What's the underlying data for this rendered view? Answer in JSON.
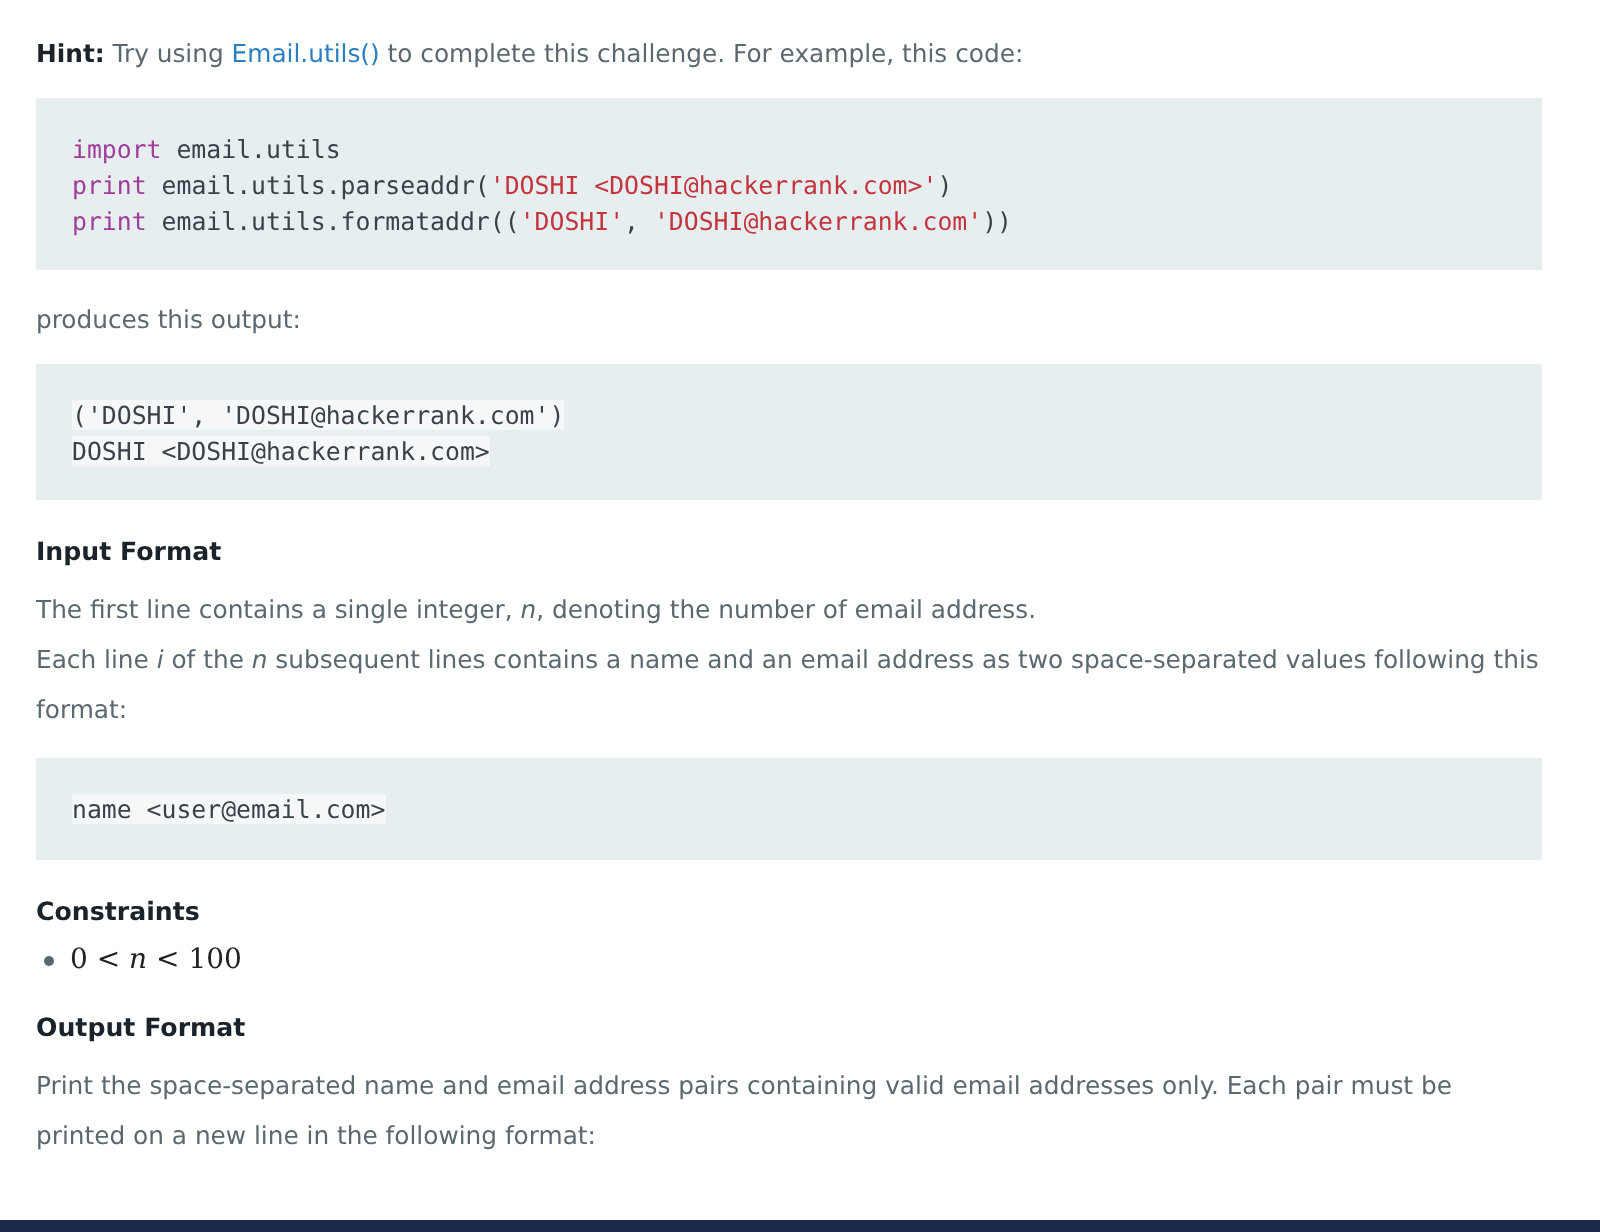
{
  "hint": {
    "label": "Hint:",
    "text_before": "Try using",
    "link": "Email.utils()",
    "text_after": "to complete this challenge. For example, this code:"
  },
  "code_example": [
    [
      {
        "kind": "keyword",
        "text": "import"
      },
      {
        "kind": "plain",
        "text": " email.utils"
      }
    ],
    [
      {
        "kind": "keyword",
        "text": "print"
      },
      {
        "kind": "plain",
        "text": " email.utils.parseaddr("
      },
      {
        "kind": "string",
        "text": "'DOSHI <DOSHI@hackerrank.com>'"
      },
      {
        "kind": "plain",
        "text": ")"
      }
    ],
    [
      {
        "kind": "keyword",
        "text": "print"
      },
      {
        "kind": "plain",
        "text": " email.utils.formataddr(("
      },
      {
        "kind": "string",
        "text": "'DOSHI'"
      },
      {
        "kind": "plain",
        "text": ", "
      },
      {
        "kind": "string",
        "text": "'DOSHI@hackerrank.com'"
      },
      {
        "kind": "plain",
        "text": "))"
      }
    ]
  ],
  "output_intro": "produces this output:",
  "output_example": [
    "('DOSHI', 'DOSHI@hackerrank.com')",
    "DOSHI <DOSHI@hackerrank.com>"
  ],
  "input_format": {
    "heading": "Input Format",
    "paragraphs": [
      "The first line contains a single integer, *n*, denoting the number of email address.",
      "Each line *i* of the *n* subsequent lines contains a name and an email address as two space-separated values following this format:"
    ],
    "code": [
      "name <user@email.com>"
    ]
  },
  "constraints": {
    "heading": "Constraints",
    "items": [
      "0 < *n* < 100"
    ]
  },
  "output_format": {
    "heading": "Output Format",
    "paragraphs": [
      "Print the space-separated name and email address pairs containing valid email addresses only. Each pair must be printed on a new line in the following format:"
    ]
  }
}
